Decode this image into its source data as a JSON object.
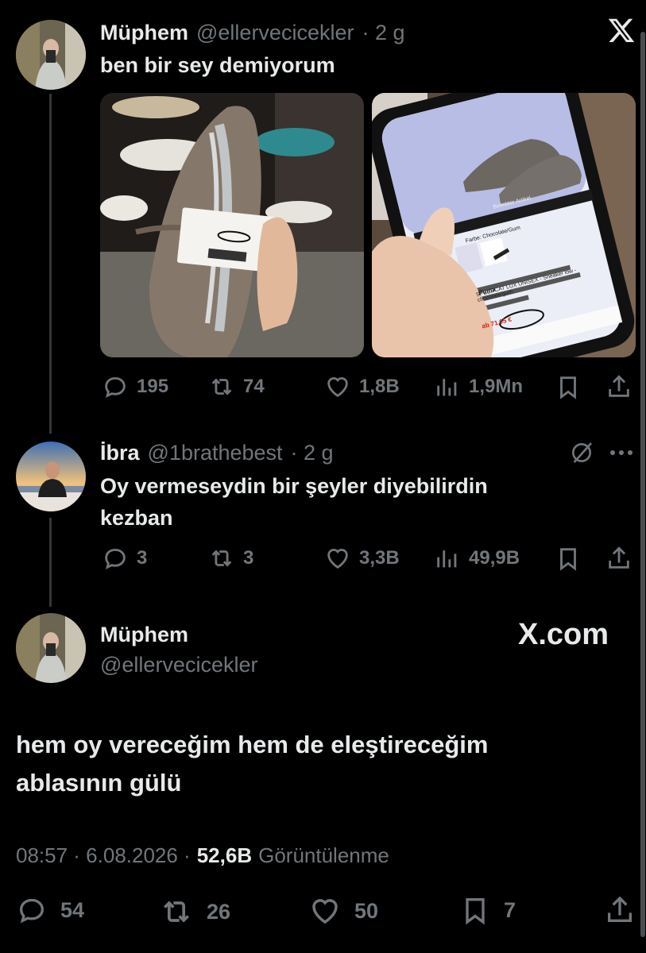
{
  "tweet1": {
    "name": "Müphem",
    "handle": "@ellervecicekler",
    "time": "· 2 g",
    "text": "ben bir sey demiyorum",
    "replies": "195",
    "retweets": "74",
    "likes": "1,8B",
    "views": "1,9Mn",
    "photo2_header": "Beliebter Artikel",
    "photo2_color": "Farbe: Chocolate/Gum",
    "photo2_brand": "Puma",
    "photo2_product": "SPEEDCAT LUX UNISEX - Sneaker low - chocolate/gum",
    "photo2_price": "ab 71,95 €"
  },
  "tweet2": {
    "name": "İbra",
    "handle": "@1brathebest",
    "time": "· 2 g",
    "text": "Oy vermeseydin bir şeyler diyebilirdin kezban",
    "replies": "3",
    "retweets": "3",
    "likes": "3,3B",
    "views": "49,9B"
  },
  "tweet3": {
    "name": "Müphem",
    "handle": "@ellervecicekler",
    "text": "hem oy vereceğim hem de eleştireceğim ablasının gülü",
    "timestamp": "08:57 · 6.08.2026 ·",
    "views_count": "52,6B",
    "views_label": "Görüntülenme",
    "replies": "54",
    "retweets": "26",
    "likes": "50",
    "bookmarks": "7"
  },
  "watermark": "X.com",
  "colors": {
    "background": "#000000",
    "text": "#e7e9ea",
    "muted": "#71767b"
  }
}
